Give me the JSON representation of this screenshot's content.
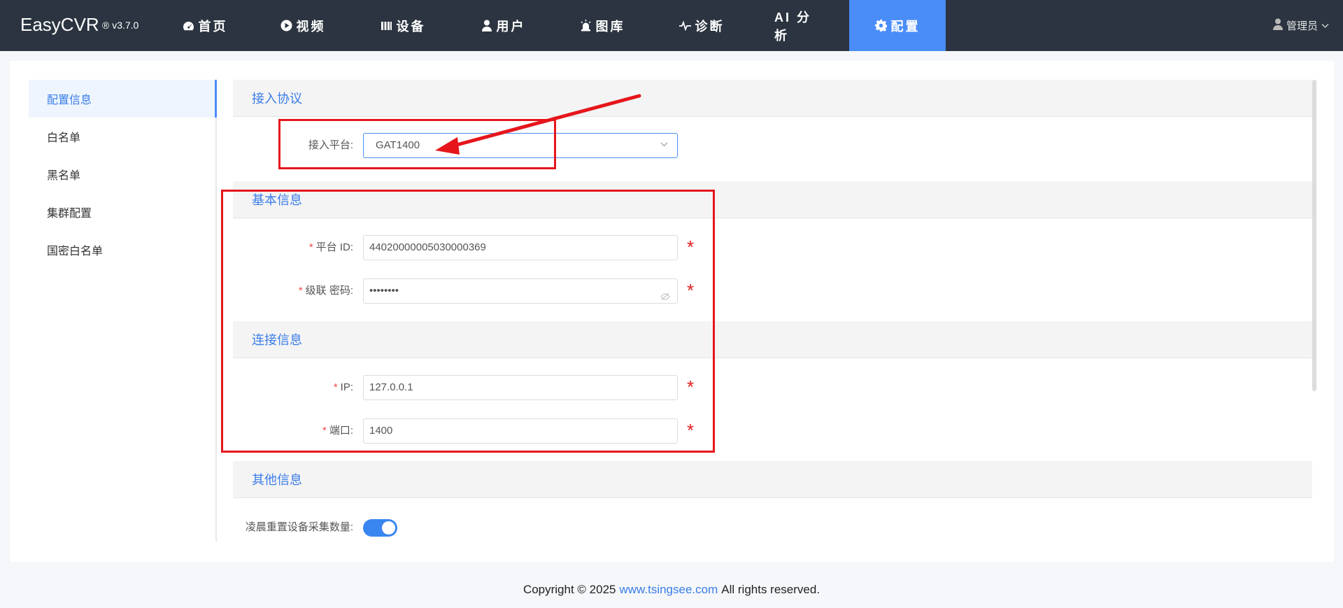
{
  "header": {
    "brand": "EasyCVR",
    "version": "® v3.7.0",
    "nav": [
      {
        "label": "首页",
        "icon": "dashboard-icon"
      },
      {
        "label": "视频",
        "icon": "play-icon"
      },
      {
        "label": "设备",
        "icon": "device-icon"
      },
      {
        "label": "用户",
        "icon": "user-icon"
      },
      {
        "label": "图库",
        "icon": "alarm-icon"
      },
      {
        "label": "诊断",
        "icon": "pulse-icon"
      },
      {
        "label": "AI 分析",
        "icon": ""
      },
      {
        "label": "配置",
        "icon": "gear-icon",
        "active": true
      }
    ],
    "user": "管理员"
  },
  "sidebar": {
    "items": [
      {
        "label": "配置信息",
        "active": true
      },
      {
        "label": "白名单"
      },
      {
        "label": "黑名单"
      },
      {
        "label": "集群配置"
      },
      {
        "label": "国密白名单"
      }
    ]
  },
  "sections": {
    "protocol": {
      "title": "接入协议",
      "platform_label": "接入平台:",
      "platform_value": "GAT1400"
    },
    "basic": {
      "title": "基本信息",
      "id_label": "平台 ID:",
      "id_value": "44020000005030000369",
      "pwd_label": "级联 密码:",
      "pwd_value": "••••••••"
    },
    "connect": {
      "title": "连接信息",
      "ip_label": "IP:",
      "ip_value": "127.0.0.1",
      "port_label": "端口:",
      "port_value": "1400"
    },
    "other": {
      "title": "其他信息",
      "reset_label": "凌晨重置设备采集数量:",
      "reset_on": true
    }
  },
  "footer": {
    "prefix": "Copyright © 2025",
    "link": "www.tsingsee.com",
    "suffix": "All rights reserved."
  },
  "colors": {
    "accent": "#4a8df8",
    "nav_bg": "#2b3440",
    "annotation": "#e5161c"
  }
}
